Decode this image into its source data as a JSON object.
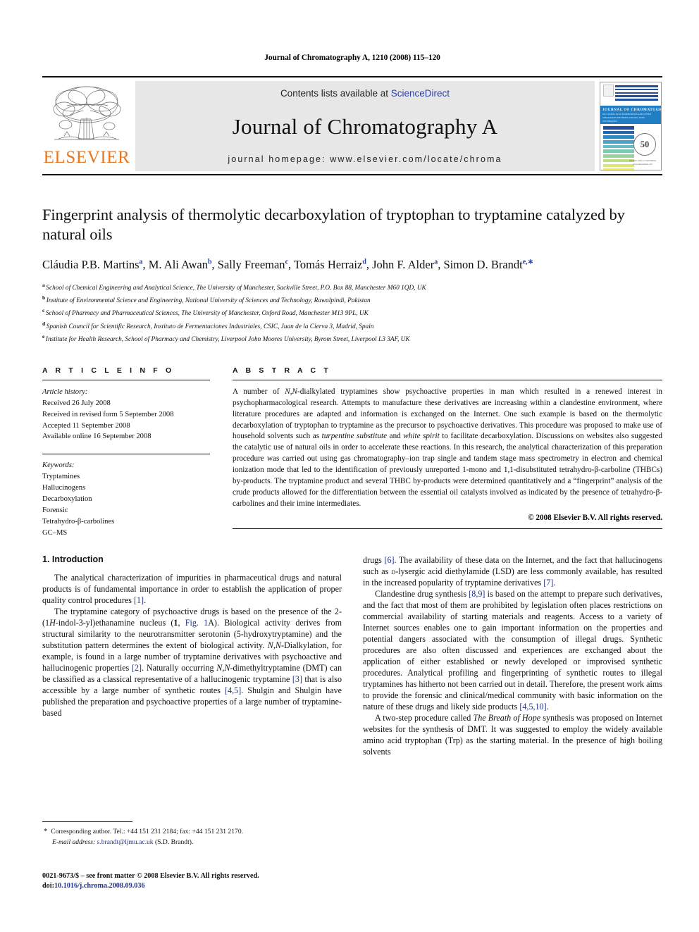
{
  "running_head": "Journal of Chromatography A, 1210 (2008) 115–120",
  "masthead": {
    "publisher_name": "ELSEVIER",
    "contents_prefix": "Contents lists available at ",
    "contents_link": "ScienceDirect",
    "journal_title": "Journal of Chromatography A",
    "homepage": "journal homepage: www.elsevier.com/locate/chroma",
    "cover": {
      "title_line": "JOURNAL OF CHROMATOGRAPHY A",
      "subtitle_line": "INCLUDING ELECTROPHORESIS AND OTHER SEPARATION METHODS AND RELATED TECHNIQUES",
      "badge": "50",
      "badge_sub": "YEARS",
      "footer": "Available online at ScienceDirect  www.sciencedirect.com"
    }
  },
  "article": {
    "title": "Fingerprint analysis of thermolytic decarboxylation of tryptophan to tryptamine catalyzed by natural oils",
    "authors_html": "Cláudia P.B. Martins<sup>a</sup>, M. Ali Awan<sup>b</sup>, Sally Freeman<sup>c</sup>, Tomás Herraiz<sup>d</sup>, John F. Alder<sup>a</sup>, Simon D. Brandt<sup>e,</sup><sup>∗</sup>",
    "affiliations": [
      {
        "mark": "a",
        "text": "School of Chemical Engineering and Analytical Science, The University of Manchester, Sackville Street, P.O. Box 88, Manchester M60 1QD, UK"
      },
      {
        "mark": "b",
        "text": "Institute of Environmental Science and Engineering, National University of Sciences and Technology, Rawalpindi, Pakistan"
      },
      {
        "mark": "c",
        "text": "School of Pharmacy and Pharmaceutical Sciences, The University of Manchester, Oxford Road, Manchester M13 9PL, UK"
      },
      {
        "mark": "d",
        "text": "Spanish Council for Scientific Research, Instituto de Fermentaciones Industriales, CSIC, Juan de la Cierva 3, Madrid, Spain"
      },
      {
        "mark": "e",
        "text": "Institute for Health Research, School of Pharmacy and Chemistry, Liverpool John Moores University, Byrom Street, Liverpool L3 3AF, UK"
      }
    ]
  },
  "article_info": {
    "heading": "A R T I C L E   I N F O",
    "history_label": "Article history:",
    "history": [
      "Received 26 July 2008",
      "Received in revised form 5 September 2008",
      "Accepted 11 September 2008",
      "Available online 16 September 2008"
    ],
    "keywords_label": "Keywords:",
    "keywords": [
      "Tryptamines",
      "Hallucinogens",
      "Decarboxylation",
      "Forensic",
      "Tetrahydro-β-carbolines",
      "GC–MS"
    ]
  },
  "abstract": {
    "heading": "A B S T R A C T",
    "body_html": "A number of <span class=\"it\">N,N</span>-dialkylated tryptamines show psychoactive properties in man which resulted in a renewed interest in psychopharmacological research. Attempts to manufacture these derivatives are increasing within a clandestine environment, where literature procedures are adapted and information is exchanged on the Internet. One such example is based on the thermolytic decarboxylation of tryptophan to tryptamine as the precursor to psychoactive derivatives. This procedure was proposed to make use of household solvents such as <span class=\"it\">turpentine substitute</span> and <span class=\"it\">white spirit</span> to facilitate decarboxylation. Discussions on websites also suggested the catalytic use of natural oils in order to accelerate these reactions. In this research, the analytical characterization of this preparation procedure was carried out using gas chromatography–ion trap single and tandem stage mass spectrometry in electron and chemical ionization mode that led to the identification of previously unreported 1-mono and 1,1-disubstituted tetrahydro-β-carboline (THBCs) by-products. The tryptamine product and several THBC by-products were determined quantitatively and a “fingerprint” analysis of the crude products allowed for the differentiation between the essential oil catalysts involved as indicated by the presence of tetrahydro-β-carbolines and their imine intermediates.",
    "copyright": "© 2008 Elsevier B.V. All rights reserved."
  },
  "body": {
    "section_heading": "1.  Introduction",
    "left_paragraphs_html": [
      "The analytical characterization of impurities in pharmaceutical drugs and natural products is of fundamental importance in order to establish the application of proper quality control procedures <span class=\"ref\">[1]</span>.",
      "The tryptamine category of psychoactive drugs is based on the presence of the 2-(1<span class=\"it\">H</span>-indol-3-yl)ethanamine nucleus (<span class=\"bd\">1</span>, <span class=\"ref\">Fig. 1</span>A). Biological activity derives from structural similarity to the neurotransmitter serotonin (5-hydroxytryptamine) and the substitution pattern determines the extent of biological activity. <span class=\"it\">N,N</span>-Dialkylation, for example, is found in a large number of tryptamine derivatives with psychoactive and hallucinogenic properties <span class=\"ref\">[2]</span>. Naturally occurring <span class=\"it\">N,N</span>-dimethyltryptamine (DMT) can be classified as a classical representative of a hallucinogenic tryptamine <span class=\"ref\">[3]</span> that is also accessible by a large number of synthetic routes <span class=\"ref\">[4,5]</span>. Shulgin and Shulgin have published the preparation and psychoactive properties of a large number of tryptamine-based"
    ],
    "right_paragraphs_html": [
      "drugs <span class=\"ref\">[6]</span>. The availability of these data on the Internet, and the fact that hallucinogens such as <span style=\"font-variant:small-caps\">d</span>-lysergic acid diethylamide (LSD) are less commonly available, has resulted in the increased popularity of tryptamine derivatives <span class=\"ref\">[7]</span>.",
      "Clandestine drug synthesis <span class=\"ref\">[8,9]</span> is based on the attempt to prepare such derivatives, and the fact that most of them are prohibited by legislation often places restrictions on commercial availability of starting materials and reagents. Access to a variety of Internet sources enables one to gain important information on the properties and potential dangers associated with the consumption of illegal drugs. Synthetic procedures are also often discussed and experiences are exchanged about the application of either established or newly developed or improvised synthetic procedures. Analytical profiling and fingerprinting of synthetic routes to illegal tryptamines has hitherto not been carried out in detail. Therefore, the present work aims to provide the forensic and clinical/medical community with basic information on the nature of these drugs and likely side products <span class=\"ref\">[4,5,10]</span>.",
      "A two-step procedure called <span class=\"it\">The Breath of Hope</span> synthesis was proposed on Internet websites for the synthesis of DMT. It was suggested to employ the widely available amino acid tryptophan (Trp) as the starting material. In the presence of high boiling solvents"
    ]
  },
  "footnote": {
    "text_html": "<span class=\"star\">*</span>&nbsp; Corresponding author. Tel.: +44 151 231 2184; fax: +44 151 231 2170.<br><span class=\"it\">E-mail address:</span> <span class=\"mail\">s.brandt@ljmu.ac.uk</span> (S.D. Brandt).",
    "star": "*"
  },
  "imprint": {
    "line1": "0021-9673/$ – see front matter © 2008 Elsevier B.V. All rights reserved.",
    "doi_label": "doi:",
    "doi_value": "10.1016/j.chroma.2008.09.036"
  },
  "colors": {
    "elsevier_orange": "#e87722",
    "link_blue": "#24348c",
    "sciencedirect_blue": "#2b3fa0",
    "masthead_grey": "#e7e7e7",
    "cover_band_blue": "#1f7ec4"
  }
}
